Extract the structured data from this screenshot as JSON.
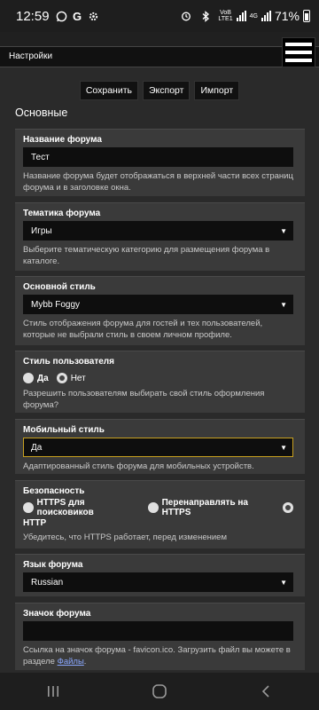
{
  "status_bar": {
    "time": "12:59",
    "icons": [
      "whatsapp-icon",
      "google-icon",
      "settings-icon"
    ],
    "network_top": "VoB",
    "network_mid": "LTE1",
    "network_bottom": "4G",
    "battery": "71%"
  },
  "header": {
    "title": "Настройки"
  },
  "toolbar": {
    "save_label": "Сохранить",
    "export_label": "Экспорт",
    "import_label": "Импорт"
  },
  "section": {
    "title": "Основные"
  },
  "fields": {
    "forum_name": {
      "label": "Название форума",
      "value": "Тест",
      "help": "Название форума будет отображаться в верхней части всех страниц форума и в заголовке окна."
    },
    "forum_topic": {
      "label": "Тематика форума",
      "value": "Игры",
      "help": "Выберите тематическую категорию для размещения форума в каталоге."
    },
    "main_style": {
      "label": "Основной стиль",
      "value": "Mybb Foggy",
      "help": "Стиль отображения форума для гостей и тех пользователей, которые не выбрали стиль в своем личном профиле."
    },
    "user_style": {
      "label": "Стиль пользователя",
      "option_yes": "Да",
      "option_no": "Нет",
      "selected": "Нет",
      "help": "Разрешить пользователям выбирать свой стиль оформления форума?"
    },
    "mobile_style": {
      "label": "Мобильный стиль",
      "value": "Да",
      "help": "Адаптированный стиль форума для мобильных устройств."
    },
    "security": {
      "label": "Безопасность",
      "option_1": "HTTPS для поисковиков",
      "option_2": "Перенаправлять на HTTPS",
      "option_3": "HTTP",
      "selected": "HTTP",
      "help": "Убедитесь, что HTTPS работает, перед изменением"
    },
    "language": {
      "label": "Язык форума",
      "value": "Russian"
    },
    "favicon": {
      "label": "Значок форума",
      "value": "",
      "help_prefix": "Ссылка на значок форума - favicon.ico. Загрузить файл вы можете в разделе ",
      "help_link": "Файлы",
      "help_suffix": "."
    }
  },
  "navbar": {
    "icons": [
      "recent-apps-icon",
      "home-icon",
      "back-icon"
    ]
  }
}
